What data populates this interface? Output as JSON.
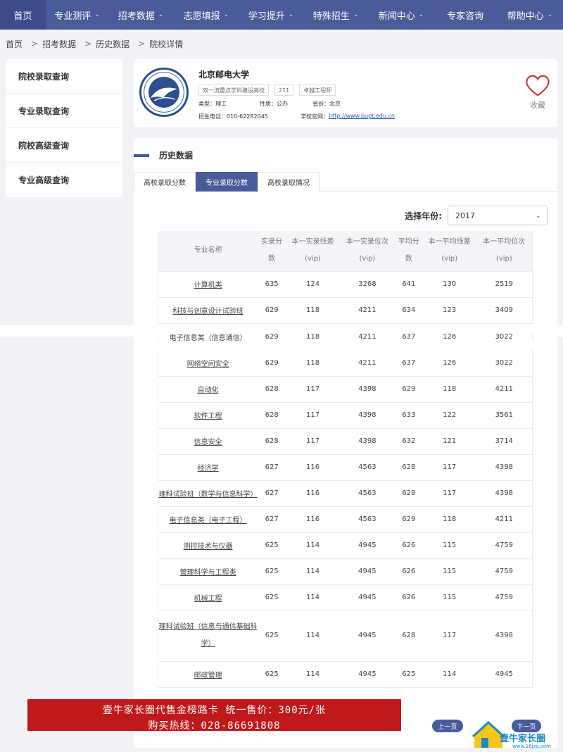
{
  "nav": {
    "items": [
      {
        "label": "首页",
        "chevron": false
      },
      {
        "label": "专业测评",
        "chevron": true
      },
      {
        "label": "招考数据",
        "chevron": true
      },
      {
        "label": "志愿填报",
        "chevron": true
      },
      {
        "label": "学习提升",
        "chevron": true
      },
      {
        "label": "特殊招生",
        "chevron": true
      },
      {
        "label": "新闻中心",
        "chevron": true
      },
      {
        "label": "专家咨询",
        "chevron": false
      },
      {
        "label": "帮助中心",
        "chevron": true
      }
    ]
  },
  "breadcrumb": [
    "首页",
    "招考数据",
    "历史数据",
    "院校详情"
  ],
  "sidebar": {
    "items": [
      "院校录取查询",
      "专业录取查询",
      "院校高级查询",
      "专业高级查询"
    ]
  },
  "university": {
    "name": "北京邮电大学",
    "tags": [
      "双一流重点学科建设高校",
      "211",
      "卓越工程师"
    ],
    "type_label": "类型：理工",
    "nature_label": "性质：公办",
    "province_label": "省份：北京",
    "phone_label": "招生电话：010-62282045",
    "website_label": "学校官网：",
    "website_url": "http://www.bupt.edu.cn",
    "favorite_label": "收藏"
  },
  "section": {
    "title": "历史数据"
  },
  "tabs": [
    {
      "label": "高校录取分数",
      "active": false
    },
    {
      "label": "专业录取分数",
      "active": true
    },
    {
      "label": "高校录取情况",
      "active": false
    }
  ],
  "year": {
    "label": "选择年份:",
    "value": "2017"
  },
  "table": {
    "headers": [
      [
        "专业名称"
      ],
      [
        "实录分",
        "数"
      ],
      [
        "本一实录线差",
        "(vip)"
      ],
      [
        "本一实录位次",
        "(vip)"
      ],
      [
        "平均分",
        "数"
      ],
      [
        "本一平均线差",
        "(vip)"
      ],
      [
        "本一平均位次",
        "(vip)"
      ]
    ],
    "rows_top": [
      [
        "计算机类",
        "635",
        "124",
        "3268",
        "641",
        "130",
        "2519"
      ],
      [
        "科技与创意设计试验班",
        "629",
        "118",
        "4211",
        "634",
        "123",
        "3409"
      ]
    ],
    "torn_row": [
      "电子信息类（信息通信）",
      "629",
      "118",
      "4211",
      "637",
      "126",
      "3022"
    ],
    "rows_bottom": [
      [
        "网络空间安全",
        "629",
        "118",
        "4211",
        "637",
        "126",
        "3022"
      ],
      [
        "自动化",
        "628",
        "117",
        "4398",
        "629",
        "118",
        "4211"
      ],
      [
        "软件工程",
        "628",
        "117",
        "4398",
        "633",
        "122",
        "3561"
      ],
      [
        "信息安全",
        "628",
        "117",
        "4398",
        "632",
        "121",
        "3714"
      ],
      [
        "经济学",
        "627",
        "116",
        "4563",
        "628",
        "117",
        "4398"
      ],
      [
        "理科试验班（数学与信息科学）",
        "627",
        "116",
        "4563",
        "628",
        "117",
        "4398"
      ],
      [
        "电子信息类（电子工程）",
        "627",
        "116",
        "4563",
        "629",
        "118",
        "4211"
      ],
      [
        "测控技术与仪器",
        "625",
        "114",
        "4945",
        "626",
        "115",
        "4759"
      ],
      [
        "管理科学与工程类",
        "625",
        "114",
        "4945",
        "626",
        "115",
        "4759"
      ],
      [
        "机械工程",
        "625",
        "114",
        "4945",
        "626",
        "115",
        "4759"
      ],
      [
        "理科试验班（信息与通信基础科学）",
        "625",
        "114",
        "4945",
        "628",
        "117",
        "4398"
      ],
      [
        "邮政管理",
        "625",
        "114",
        "4945",
        "625",
        "114",
        "4945"
      ]
    ]
  },
  "ad": {
    "line1": "壹牛家长圈代售金榜路卡  统一售价：300元/张",
    "line2": "购买热线：028-86691808"
  },
  "pager": {
    "prev": "上一页",
    "next": "下一页"
  },
  "watermark": {
    "text": "壹牛家长圈",
    "url": "www.16jzq.com"
  },
  "colors": {
    "primary": "#4a5b9a",
    "ad_red": "#c0191b",
    "heart": "#c0392b"
  }
}
